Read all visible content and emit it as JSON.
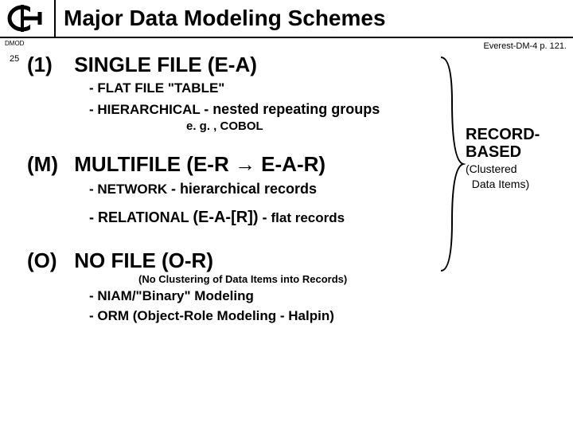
{
  "header": {
    "title": "Major  Data Modeling Schemes"
  },
  "meta": {
    "topLeft": "DMOD",
    "topRight": "Everest-DM-4 p. 121.",
    "slideNum": "25"
  },
  "sections": {
    "s1": {
      "tag": "(1)",
      "title": "SINGLE  FILE  (E-A)",
      "bullet1_pre": "-  FLAT  FILE  \"TABLE\"",
      "bullet2_pre": "-  HIERARCHICAL ",
      "bullet2_mid": "- ",
      "bullet2_post": "nested repeating groups",
      "eg": "e. g. , COBOL"
    },
    "sM": {
      "tag": "(M)",
      "title": "MULTIFILE  (E-R → E-A-R)",
      "bullet1_pre": "-  NETWORK  ",
      "bullet1_mid": "- ",
      "bullet1_post": "hierarchical records",
      "bullet2_pre": "-  RELATIONAL  ",
      "bullet2_paren": "(E-A-[R])",
      "bullet2_mid": "  - ",
      "bullet2_post": "flat records"
    },
    "sO": {
      "tag": "(O)",
      "title": "NO  FILE  (O-R)",
      "note": "(No Clustering of Data Items into Records)",
      "bullet1": "-  NIAM/\"Binary\" Modeling",
      "bullet2": "-  ORM (Object-Role Modeling - Halpin)"
    }
  },
  "rightAnnot": {
    "line1": "RECORD-",
    "line2": "BASED",
    "paren1": "(Clustered",
    "paren2": "  Data Items)"
  }
}
